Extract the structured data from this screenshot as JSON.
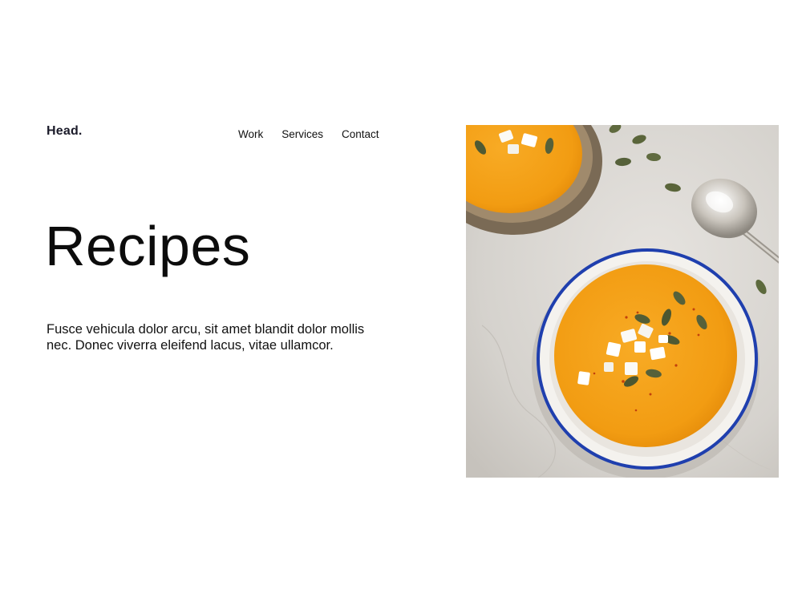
{
  "brand": {
    "logo_text": "Head."
  },
  "nav": {
    "items": [
      {
        "label": "Work"
      },
      {
        "label": "Services"
      },
      {
        "label": "Contact"
      }
    ]
  },
  "hero": {
    "title": "Recipes",
    "description": "Fusce vehicula dolor arcu, sit amet blandit dolor mollis nec. Donec viverra eleifend lacus, vitae ullamcor."
  },
  "image": {
    "subject": "bowls of pumpkin soup with pumpkin seeds and feta on stone surface"
  },
  "colors": {
    "soup": "#f3a11c",
    "surface": "#dad7d3",
    "bowl_rim": "#1f3fae"
  }
}
